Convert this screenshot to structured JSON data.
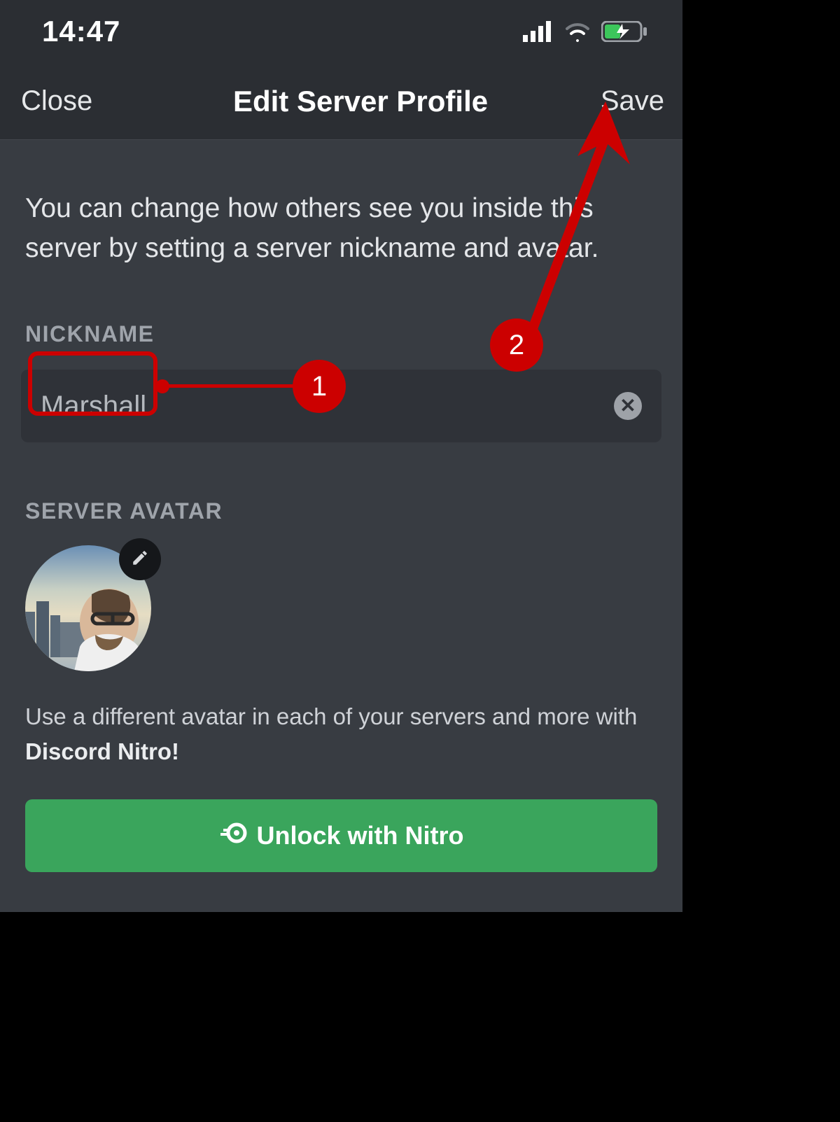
{
  "statusbar": {
    "time": "14:47"
  },
  "header": {
    "close_label": "Close",
    "title": "Edit Server Profile",
    "save_label": "Save"
  },
  "description": "You can change how others see you inside this server by setting a server nickname and avatar.",
  "nickname": {
    "label": "NICKNAME",
    "value": "Marshall"
  },
  "avatar": {
    "label": "SERVER AVATAR",
    "nitro_text_prefix": "Use a different avatar in each of your servers and more with ",
    "nitro_text_bold": "Discord Nitro!"
  },
  "nitro_button": "Unlock with Nitro",
  "annotations": {
    "badge1": "1",
    "badge2": "2"
  }
}
